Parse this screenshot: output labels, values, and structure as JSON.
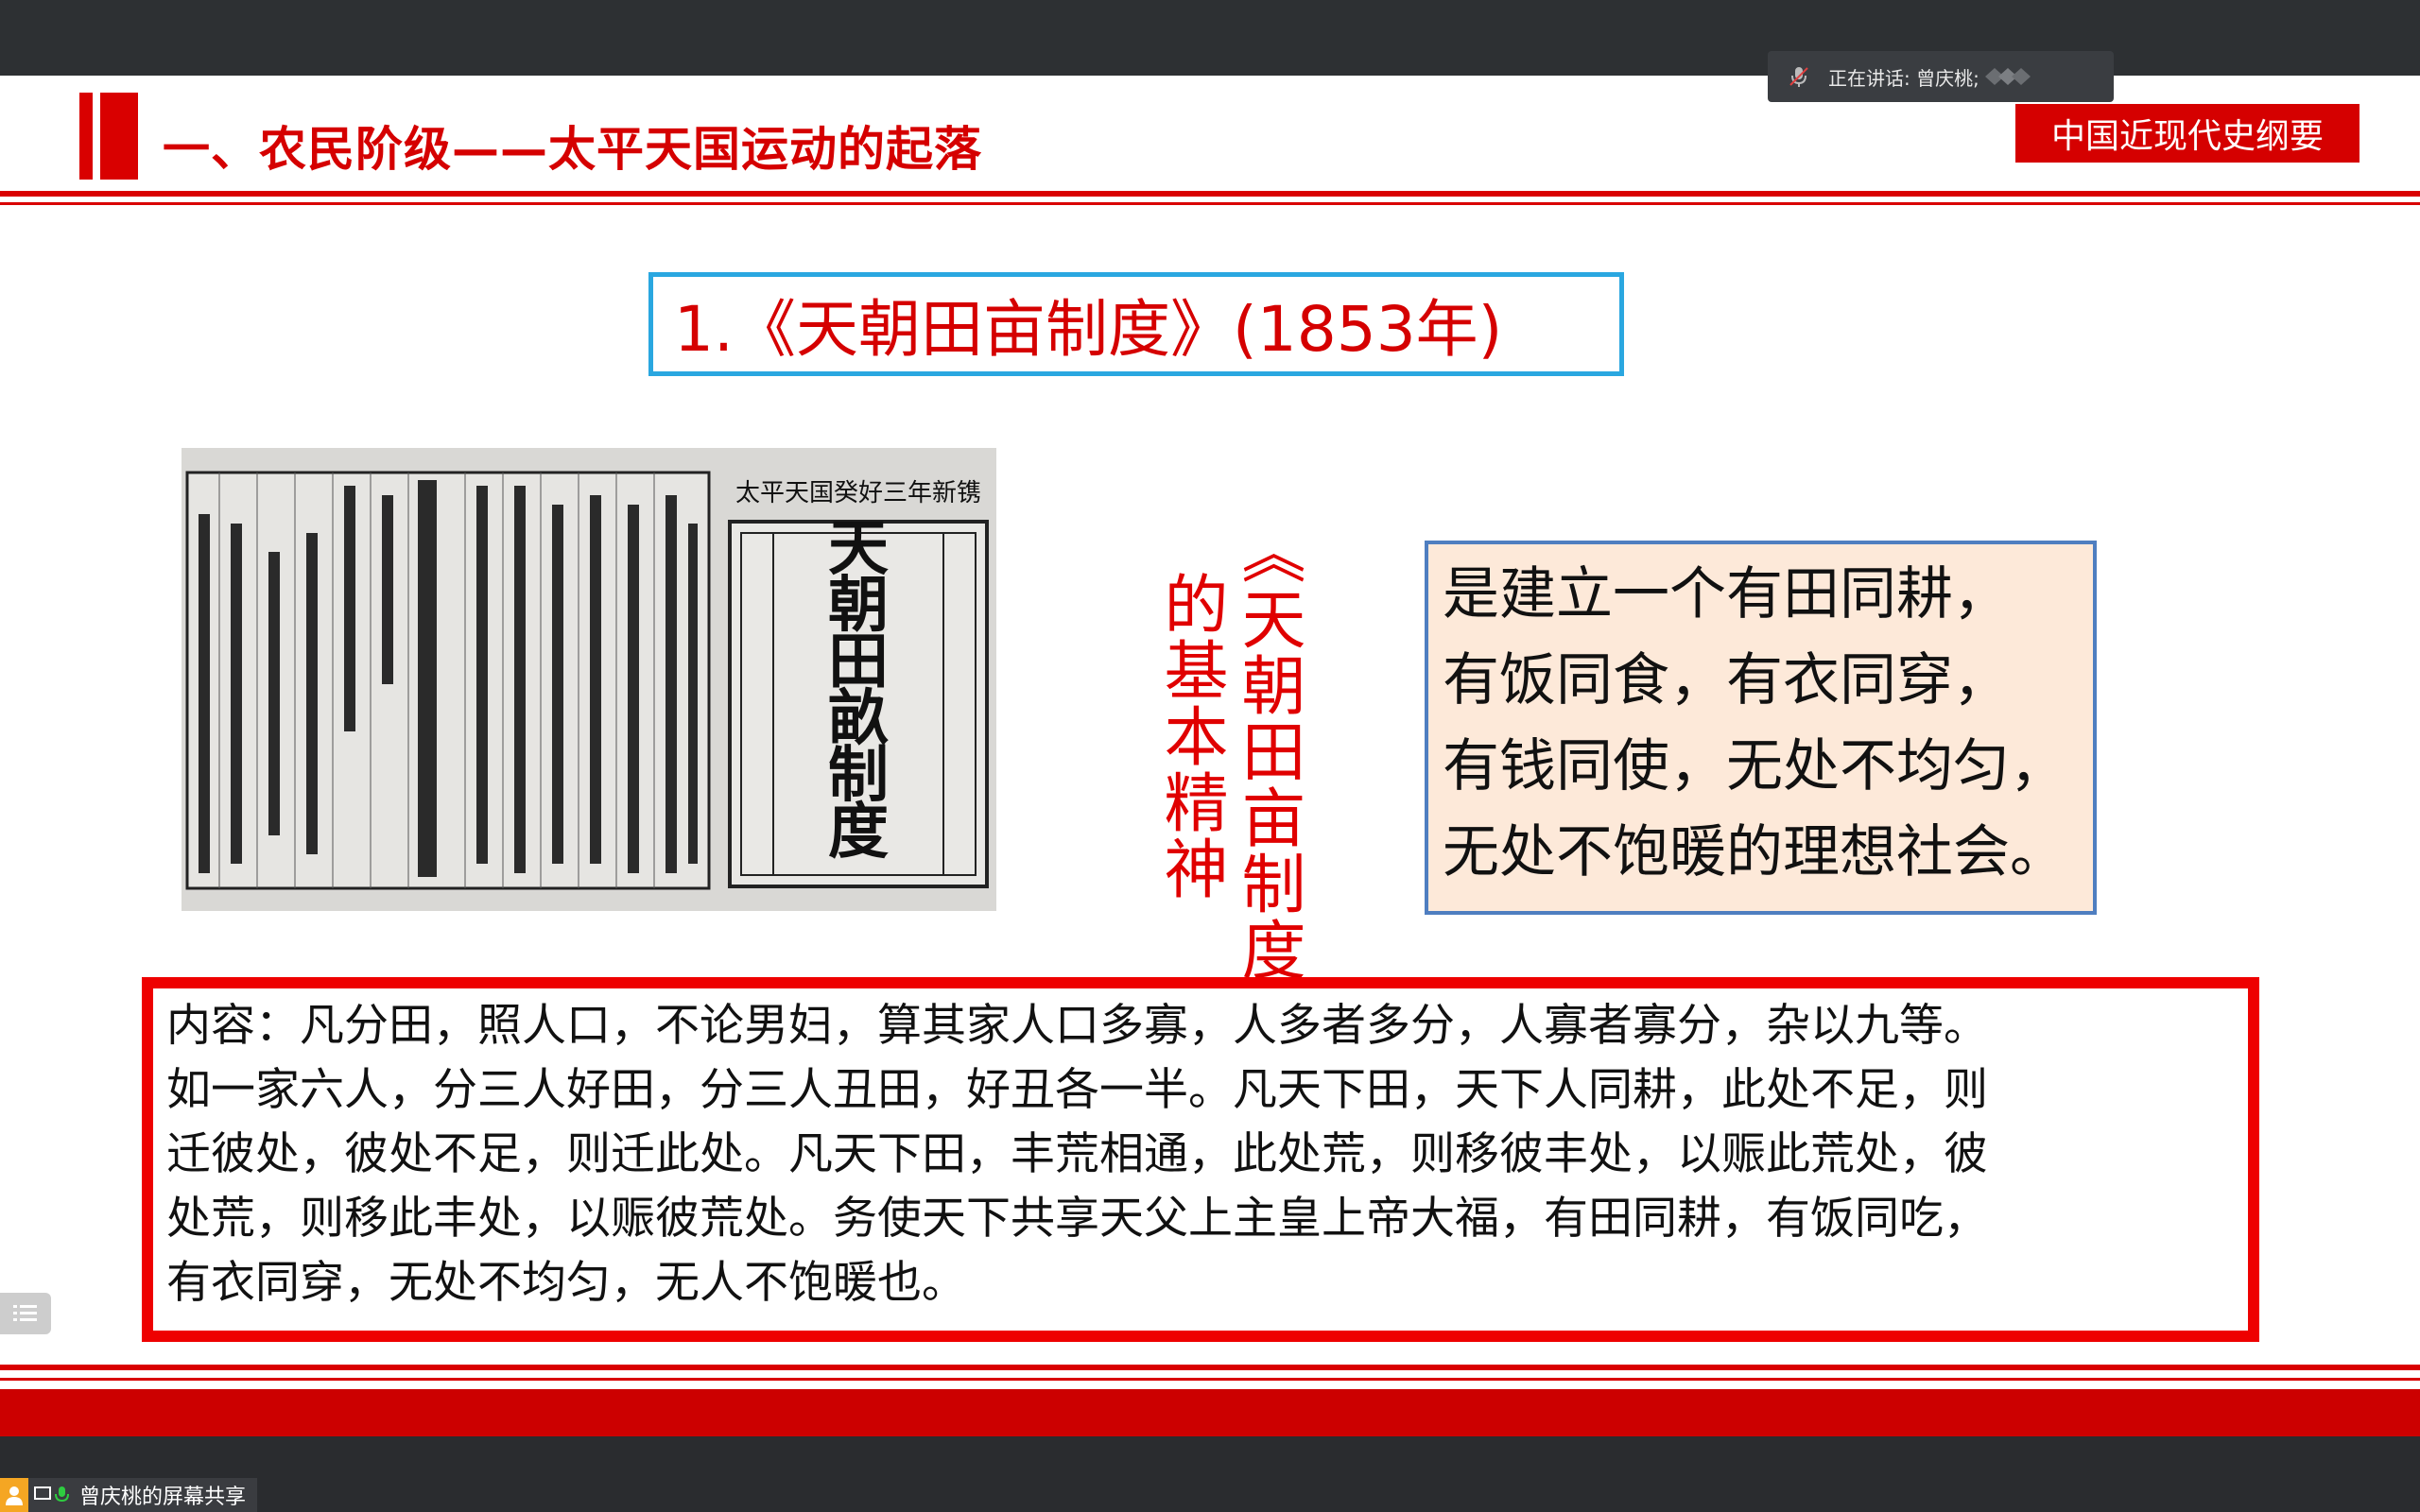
{
  "slide": {
    "header_title": "一、农民阶级——太平天国运动的起落",
    "course_badge": "中国近现代史纲要",
    "section_title": "1.《天朝田亩制度》(1853年)",
    "vertical_caption_1": "《天朝田亩制度》",
    "vertical_caption_2": "的基本精神",
    "spirit_lines": [
      "是建立一个有田同耕，",
      "有饭同食，有衣同穿，",
      "有钱同使，无处不均匀，",
      "无处不饱暖的理想社会。"
    ],
    "content_lines": [
      "内容：凡分田，照人口，不论男妇，算其家人口多寡，人多者多分，人寡者寡分，杂以九等。",
      "如一家六人，分三人好田，分三人丑田，好丑各一半。凡天下田，天下人同耕，此处不足，则",
      "迁彼处，彼处不足，则迁此处。凡天下田，丰荒相通，此处荒，则移彼丰处，以赈此荒处，彼",
      "处荒，则移此丰处，以赈彼荒处。务使天下共享天父上主皇上帝大福，有田同耕，有饭同吃，",
      "有衣同穿，无处不均匀，无人不饱暖也。"
    ],
    "doc_image": {
      "cover_title": "天朝田畝制度",
      "cover_header": "太平天国癸好三年新镌"
    }
  },
  "meeting": {
    "speaking_label": "正在讲话: 曾庆桃;",
    "share_label": "曾庆桃的屏幕共享"
  },
  "colors": {
    "accent_red": "#d50000",
    "title_border": "#2aa7e0",
    "spirit_bg": "#fde9d9",
    "spirit_border": "#4f7ec0"
  }
}
